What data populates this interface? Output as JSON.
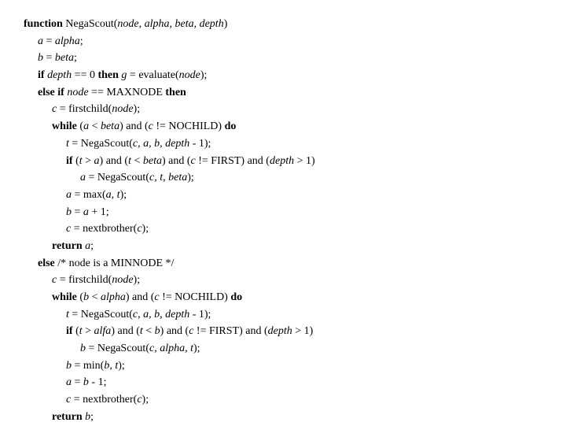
{
  "code": {
    "lines": [
      {
        "id": "L1",
        "indent": 0,
        "parts": [
          {
            "t": "kw",
            "v": "function "
          },
          {
            "t": "plain",
            "v": "NegaScout("
          },
          {
            "t": "it",
            "v": "node, alpha, beta, depth"
          },
          {
            "t": "plain",
            "v": ")"
          }
        ]
      },
      {
        "id": "L2",
        "indent": 1,
        "parts": [
          {
            "t": "it",
            "v": "a"
          },
          {
            "t": "plain",
            "v": " = "
          },
          {
            "t": "it",
            "v": "alpha"
          },
          {
            "t": "plain",
            "v": ";"
          }
        ]
      },
      {
        "id": "L3",
        "indent": 1,
        "parts": [
          {
            "t": "it",
            "v": "b"
          },
          {
            "t": "plain",
            "v": " = "
          },
          {
            "t": "it",
            "v": "beta"
          },
          {
            "t": "plain",
            "v": ";"
          }
        ]
      },
      {
        "id": "L4",
        "indent": 1,
        "parts": [
          {
            "t": "kw",
            "v": "if "
          },
          {
            "t": "it",
            "v": "depth"
          },
          {
            "t": "plain",
            "v": " == 0 "
          },
          {
            "t": "kw",
            "v": "then "
          },
          {
            "t": "it",
            "v": "g"
          },
          {
            "t": "plain",
            "v": " = evaluate("
          },
          {
            "t": "it",
            "v": "node"
          },
          {
            "t": "plain",
            "v": ");"
          }
        ]
      },
      {
        "id": "L5",
        "indent": 1,
        "parts": [
          {
            "t": "kw",
            "v": "else if "
          },
          {
            "t": "it",
            "v": "node"
          },
          {
            "t": "plain",
            "v": " == MAXNODE "
          },
          {
            "t": "kw",
            "v": "then"
          }
        ]
      },
      {
        "id": "L6",
        "indent": 2,
        "parts": [
          {
            "t": "it",
            "v": "c"
          },
          {
            "t": "plain",
            "v": " = firstchild("
          },
          {
            "t": "it",
            "v": "node"
          },
          {
            "t": "plain",
            "v": ");"
          }
        ]
      },
      {
        "id": "L7",
        "indent": 2,
        "parts": [
          {
            "t": "kw",
            "v": "while "
          },
          {
            "t": "plain",
            "v": "("
          },
          {
            "t": "it",
            "v": "a"
          },
          {
            "t": "plain",
            "v": " < "
          },
          {
            "t": "it",
            "v": "beta"
          },
          {
            "t": "plain",
            "v": ") and ("
          },
          {
            "t": "it",
            "v": "c"
          },
          {
            "t": "plain",
            "v": " != NOCHILD) "
          },
          {
            "t": "kw",
            "v": "do"
          }
        ]
      },
      {
        "id": "L8",
        "indent": 3,
        "parts": [
          {
            "t": "it",
            "v": "t"
          },
          {
            "t": "plain",
            "v": " = NegaScout("
          },
          {
            "t": "it",
            "v": "c, a, b, depth"
          },
          {
            "t": "plain",
            "v": " - 1);"
          }
        ]
      },
      {
        "id": "L9",
        "indent": 3,
        "parts": [
          {
            "t": "kw",
            "v": "if "
          },
          {
            "t": "plain",
            "v": "("
          },
          {
            "t": "it",
            "v": "t"
          },
          {
            "t": "plain",
            "v": " > "
          },
          {
            "t": "it",
            "v": "a"
          },
          {
            "t": "plain",
            "v": ") and ("
          },
          {
            "t": "it",
            "v": "t"
          },
          {
            "t": "plain",
            "v": " < "
          },
          {
            "t": "it",
            "v": "beta"
          },
          {
            "t": "plain",
            "v": ") and ("
          },
          {
            "t": "it",
            "v": "c"
          },
          {
            "t": "plain",
            "v": " != FIRST) and ("
          },
          {
            "t": "it",
            "v": "depth"
          },
          {
            "t": "plain",
            "v": " > 1)"
          }
        ]
      },
      {
        "id": "L10",
        "indent": 4,
        "parts": [
          {
            "t": "it",
            "v": "a"
          },
          {
            "t": "plain",
            "v": " = NegaScout("
          },
          {
            "t": "it",
            "v": "c, t, beta"
          },
          {
            "t": "plain",
            "v": ");"
          }
        ]
      },
      {
        "id": "L11",
        "indent": 3,
        "parts": [
          {
            "t": "it",
            "v": "a"
          },
          {
            "t": "plain",
            "v": " = max("
          },
          {
            "t": "it",
            "v": "a, t"
          },
          {
            "t": "plain",
            "v": ");"
          }
        ]
      },
      {
        "id": "L12",
        "indent": 3,
        "parts": [
          {
            "t": "it",
            "v": "b"
          },
          {
            "t": "plain",
            "v": " = "
          },
          {
            "t": "it",
            "v": "a"
          },
          {
            "t": "plain",
            "v": " + 1;"
          }
        ]
      },
      {
        "id": "L13",
        "indent": 3,
        "parts": [
          {
            "t": "it",
            "v": "c"
          },
          {
            "t": "plain",
            "v": " = nextbrother("
          },
          {
            "t": "it",
            "v": "c"
          },
          {
            "t": "plain",
            "v": ");"
          }
        ]
      },
      {
        "id": "L14",
        "indent": 2,
        "parts": [
          {
            "t": "kw",
            "v": "return "
          },
          {
            "t": "it",
            "v": "a"
          },
          {
            "t": "plain",
            "v": ";"
          }
        ]
      },
      {
        "id": "L15",
        "indent": 1,
        "parts": [
          {
            "t": "kw",
            "v": "else "
          },
          {
            "t": "plain",
            "v": "/* node is a MINNODE */"
          }
        ]
      },
      {
        "id": "L16",
        "indent": 2,
        "parts": [
          {
            "t": "it",
            "v": "c"
          },
          {
            "t": "plain",
            "v": " = firstchild("
          },
          {
            "t": "it",
            "v": "node"
          },
          {
            "t": "plain",
            "v": ");"
          }
        ]
      },
      {
        "id": "L17",
        "indent": 2,
        "parts": [
          {
            "t": "kw",
            "v": "while "
          },
          {
            "t": "plain",
            "v": "("
          },
          {
            "t": "it",
            "v": "b"
          },
          {
            "t": "plain",
            "v": " < "
          },
          {
            "t": "it",
            "v": "alpha"
          },
          {
            "t": "plain",
            "v": ") and ("
          },
          {
            "t": "it",
            "v": "c"
          },
          {
            "t": "plain",
            "v": " != NOCHILD) "
          },
          {
            "t": "kw",
            "v": "do"
          }
        ]
      },
      {
        "id": "L18",
        "indent": 3,
        "parts": [
          {
            "t": "it",
            "v": "t"
          },
          {
            "t": "plain",
            "v": " = NegaScout("
          },
          {
            "t": "it",
            "v": "c, a, b, depth"
          },
          {
            "t": "plain",
            "v": " - 1);"
          }
        ]
      },
      {
        "id": "L19",
        "indent": 3,
        "parts": [
          {
            "t": "kw",
            "v": "if "
          },
          {
            "t": "plain",
            "v": "("
          },
          {
            "t": "it",
            "v": "t"
          },
          {
            "t": "plain",
            "v": " > "
          },
          {
            "t": "it",
            "v": "alfa"
          },
          {
            "t": "plain",
            "v": ") and ("
          },
          {
            "t": "it",
            "v": "t"
          },
          {
            "t": "plain",
            "v": " < "
          },
          {
            "t": "it",
            "v": "b"
          },
          {
            "t": "plain",
            "v": ") and ("
          },
          {
            "t": "it",
            "v": "c"
          },
          {
            "t": "plain",
            "v": " != FIRST) and ("
          },
          {
            "t": "it",
            "v": "depth"
          },
          {
            "t": "plain",
            "v": " > 1)"
          }
        ]
      },
      {
        "id": "L20",
        "indent": 4,
        "parts": [
          {
            "t": "it",
            "v": "b"
          },
          {
            "t": "plain",
            "v": " = NegaScout("
          },
          {
            "t": "it",
            "v": "c, alpha, t"
          },
          {
            "t": "plain",
            "v": ");"
          }
        ]
      },
      {
        "id": "L21",
        "indent": 3,
        "parts": [
          {
            "t": "it",
            "v": "b"
          },
          {
            "t": "plain",
            "v": " = min("
          },
          {
            "t": "it",
            "v": "b, t"
          },
          {
            "t": "plain",
            "v": ");"
          }
        ]
      },
      {
        "id": "L22",
        "indent": 3,
        "parts": [
          {
            "t": "it",
            "v": "a"
          },
          {
            "t": "plain",
            "v": " = "
          },
          {
            "t": "it",
            "v": "b"
          },
          {
            "t": "plain",
            "v": " - 1;"
          }
        ]
      },
      {
        "id": "L23",
        "indent": 3,
        "parts": [
          {
            "t": "it",
            "v": "c"
          },
          {
            "t": "plain",
            "v": " = nextbrother("
          },
          {
            "t": "it",
            "v": "c"
          },
          {
            "t": "plain",
            "v": ");"
          }
        ]
      },
      {
        "id": "L24",
        "indent": 2,
        "parts": [
          {
            "t": "kw",
            "v": "return "
          },
          {
            "t": "it",
            "v": "b"
          },
          {
            "t": "plain",
            "v": ";"
          }
        ]
      }
    ],
    "indent_unit": 18
  }
}
